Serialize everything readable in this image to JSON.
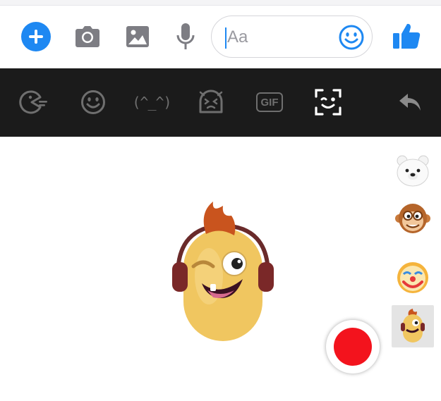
{
  "composer": {
    "input_placeholder": "Aa",
    "input_value": "",
    "icons": [
      "plus-icon",
      "camera-icon",
      "image-icon",
      "microphone-icon",
      "smile-icon",
      "thumbs-up-icon"
    ]
  },
  "mode_bar": {
    "items": [
      {
        "name": "stickers",
        "icon": "pacman-icon"
      },
      {
        "name": "emoji",
        "icon": "smile-icon"
      },
      {
        "name": "kaomoji",
        "label": "(^_^)"
      },
      {
        "name": "reaction",
        "icon": "squint-face-icon"
      },
      {
        "name": "gif",
        "label": "GIF"
      },
      {
        "name": "face-filter",
        "icon": "face-scan-icon",
        "active": true
      }
    ],
    "back_icon": "reply-arrow-icon"
  },
  "camera": {
    "masks": [
      {
        "name": "polar-bear",
        "selected": false
      },
      {
        "name": "monkey",
        "selected": false
      },
      {
        "name": "clown",
        "selected": false
      },
      {
        "name": "cyclops",
        "selected": true
      }
    ]
  },
  "colors": {
    "accent": "#1e88f2",
    "mode_bar_bg": "#1b1b1b",
    "mode_icon": "#6f6f6f",
    "record": "#f3131d"
  }
}
